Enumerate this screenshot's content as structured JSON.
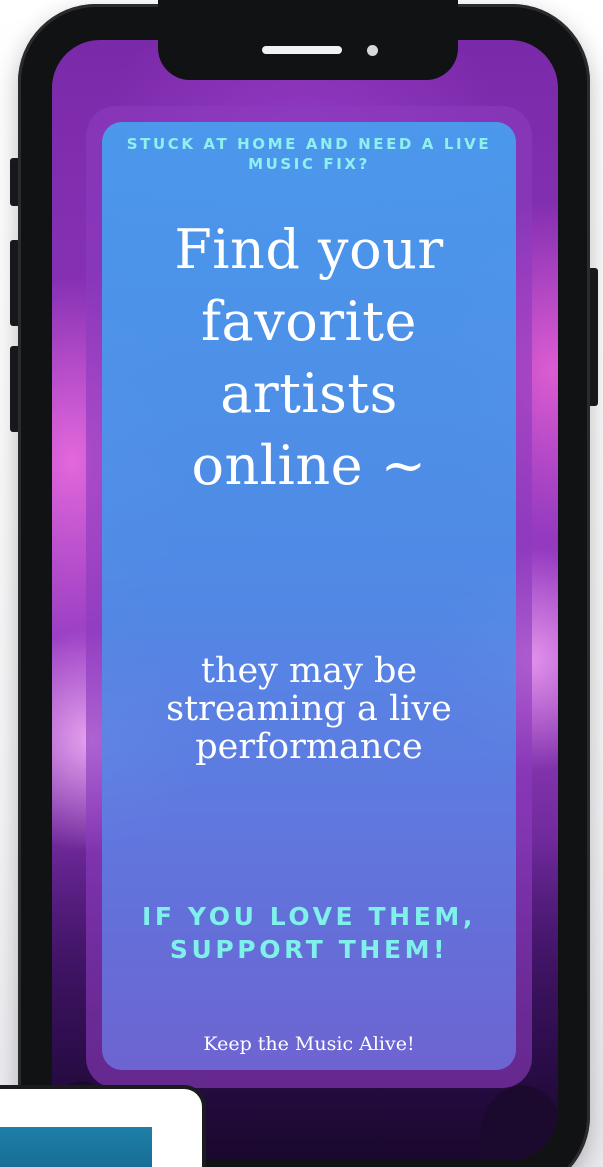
{
  "promo": {
    "eyebrow": "STUCK AT HOME AND NEED A LIVE MUSIC FIX?",
    "headline": "Find your favorite artists online ~",
    "subline": "they may be streaming  a live performance",
    "callout": "IF YOU LOVE THEM, SUPPORT THEM!",
    "signoff": "Keep the Music Alive!"
  },
  "colors": {
    "phone_body": "#111214",
    "eyebrow_text": "#8ff0f0",
    "callout_text": "#7ff0ea",
    "card_blue": "#46a0f0",
    "background_purple": "#8a33b8"
  }
}
